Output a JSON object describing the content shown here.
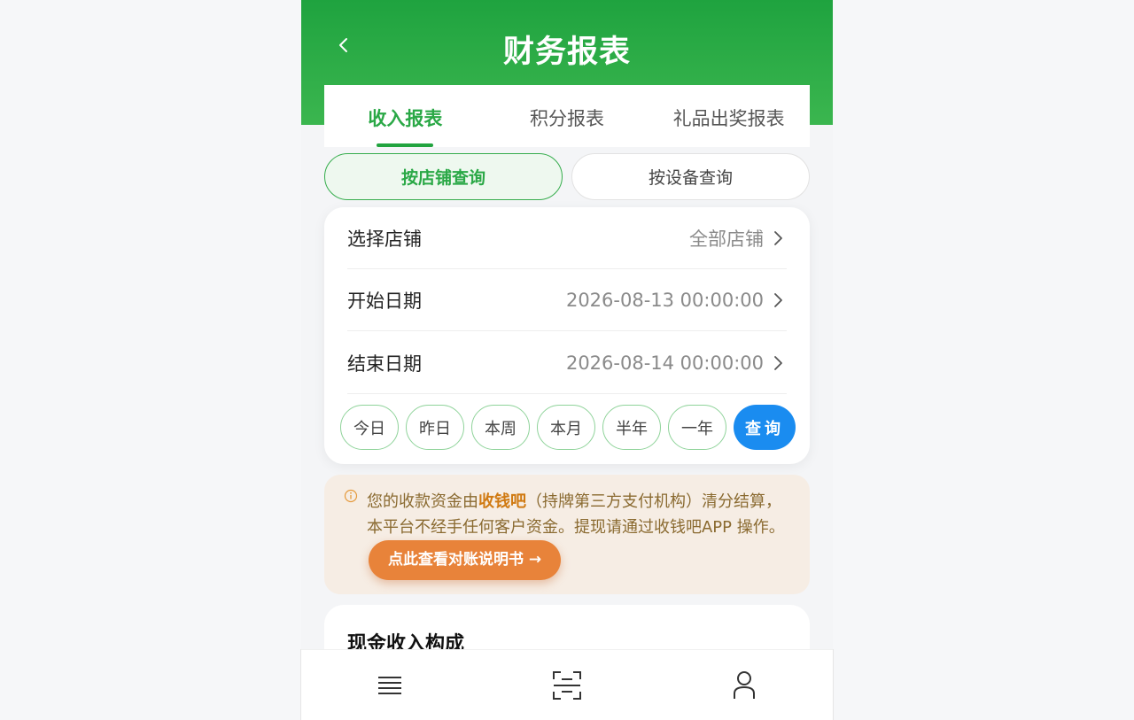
{
  "header": {
    "title": "财务报表"
  },
  "tabs": [
    {
      "label": "收入报表",
      "active": true
    },
    {
      "label": "积分报表",
      "active": false
    },
    {
      "label": "礼品出奖报表",
      "active": false
    }
  ],
  "query_modes": [
    {
      "label": "按店铺查询",
      "active": true
    },
    {
      "label": "按设备查询",
      "active": false
    }
  ],
  "filters": {
    "store": {
      "label": "选择店铺",
      "value": "全部店铺"
    },
    "start_date": {
      "label": "开始日期",
      "value": "2026-08-13 00:00:00"
    },
    "end_date": {
      "label": "结束日期",
      "value": "2026-08-14 00:00:00"
    }
  },
  "quick_ranges": [
    "今日",
    "昨日",
    "本周",
    "本月",
    "半年",
    "一年"
  ],
  "query_button": "查询",
  "notice": {
    "text_before": "您的收款资金由",
    "brand": "收钱吧",
    "text_after": "（持牌第三方支付机构）清分结算，本平台不经手任何客户资金。提现请通过收钱吧APP 操作。",
    "button": "点此查看对账说明书 →"
  },
  "income_section": {
    "title": "现金收入构成"
  },
  "bottom_nav": [
    {
      "icon": "menu-icon"
    },
    {
      "icon": "scan-icon"
    },
    {
      "icon": "user-icon"
    }
  ],
  "colors": {
    "brand_green": "#22a43f",
    "query_blue": "#1a8cf0",
    "notice_bg": "#f6ede4",
    "guide_orange": "#e8833a"
  }
}
